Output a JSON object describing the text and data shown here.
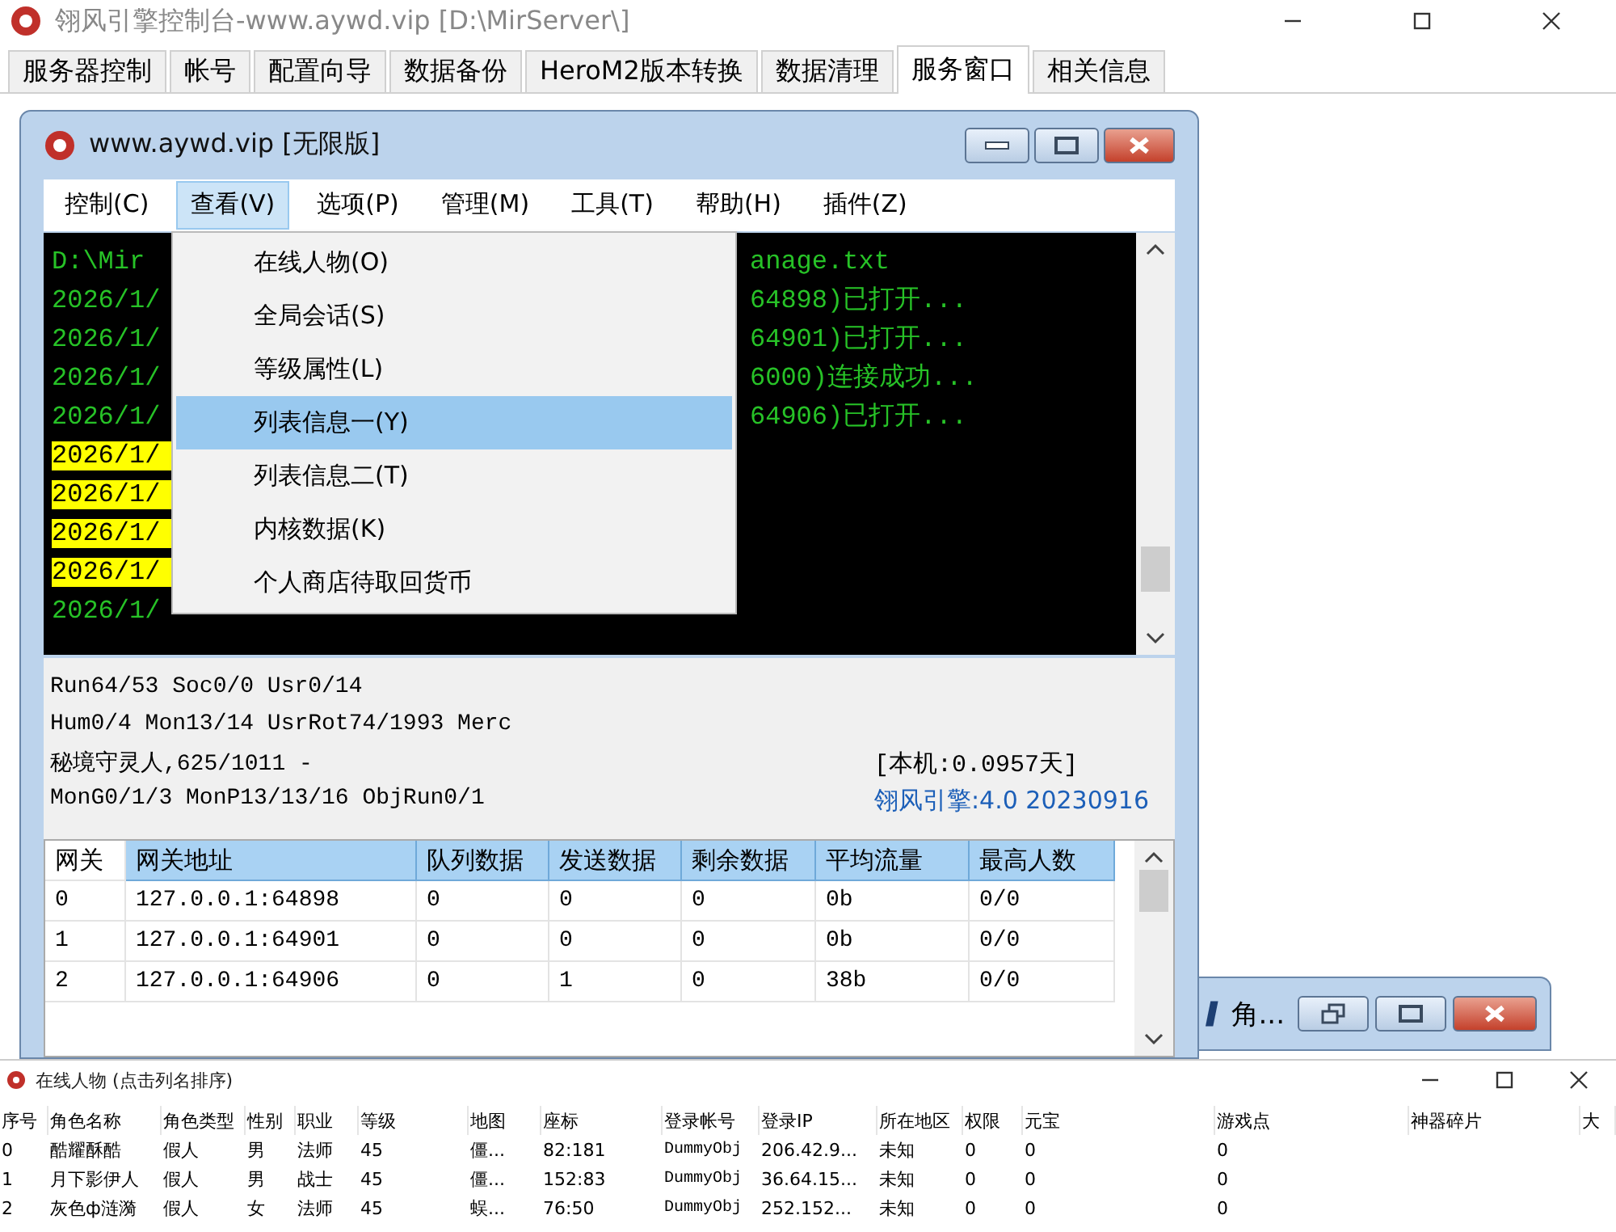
{
  "window": {
    "title": "翎风引擎控制台-www.aywd.vip [D:\\MirServer\\]"
  },
  "tabs": [
    {
      "label": "服务器控制",
      "selected": false
    },
    {
      "label": "帐号",
      "selected": false
    },
    {
      "label": "配置向导",
      "selected": false
    },
    {
      "label": "数据备份",
      "selected": false
    },
    {
      "label": "HeroM2版本转换",
      "selected": false
    },
    {
      "label": "数据清理",
      "selected": false
    },
    {
      "label": "服务窗口",
      "selected": true
    },
    {
      "label": "相关信息",
      "selected": false
    }
  ],
  "server_window": {
    "title": "www.aywd.vip [无限版]",
    "menu": [
      {
        "label": "控制(C)",
        "selected": false
      },
      {
        "label": "查看(V)",
        "selected": true
      },
      {
        "label": "选项(P)",
        "selected": false
      },
      {
        "label": "管理(M)",
        "selected": false
      },
      {
        "label": "工具(T)",
        "selected": false
      },
      {
        "label": "帮助(H)",
        "selected": false
      },
      {
        "label": "插件(Z)",
        "selected": false
      }
    ],
    "dropdown": [
      {
        "label": "在线人物(O)",
        "selected": false
      },
      {
        "label": "全局会话(S)",
        "selected": false
      },
      {
        "label": "等级属性(L)",
        "selected": false
      },
      {
        "label": "列表信息一(Y)",
        "selected": true
      },
      {
        "label": "列表信息二(T)",
        "selected": false
      },
      {
        "label": "内核数据(K)",
        "selected": false
      },
      {
        "label": "个人商店待取回货币",
        "selected": false
      }
    ],
    "console": [
      {
        "left": "D:\\Mir",
        "right": "anage.txt",
        "highlighted": false
      },
      {
        "left": "2026/1/",
        "right": "64898)已打开...",
        "highlighted": false
      },
      {
        "left": "2026/1/",
        "right": "64901)已打开...",
        "highlighted": false
      },
      {
        "left": "2026/1/",
        "right": "6000)连接成功...",
        "highlighted": false
      },
      {
        "left": "2026/1/",
        "right": "64906)已打开...",
        "highlighted": false
      },
      {
        "left": "2026/1/",
        "highlighted": true
      },
      {
        "left": "2026/1/",
        "highlighted": true
      },
      {
        "left": "2026/1/",
        "highlighted": true
      },
      {
        "left": "2026/1/",
        "highlighted": true
      },
      {
        "left": "2026/1/",
        "highlighted": false
      }
    ],
    "status": {
      "lines": [
        "Run64/53 Soc0/0 Usr0/14",
        "Hum0/4 Mon13/14 UsrRot74/1993 Merc",
        "秘境守灵人,625/1011 -",
        "MonG0/1/3 MonP13/13/16 ObjRun0/1"
      ],
      "local_time": "[本机:0.0957天]",
      "version": "翎风引擎:4.0 20230916"
    },
    "gateway_table": {
      "columns": [
        {
          "label": "网关",
          "highlighted": false
        },
        {
          "label": "网关地址",
          "highlighted": true
        },
        {
          "label": "队列数据",
          "highlighted": true
        },
        {
          "label": "发送数据",
          "highlighted": true
        },
        {
          "label": "剩余数据",
          "highlighted": true
        },
        {
          "label": "平均流量",
          "highlighted": true
        },
        {
          "label": "最高人数",
          "highlighted": true
        }
      ],
      "rows": [
        [
          "0",
          "127.0.0.1:64898",
          "0",
          "0",
          "0",
          "0b",
          "0/0"
        ],
        [
          "1",
          "127.0.0.1:64901",
          "0",
          "0",
          "0",
          "0b",
          "0/0"
        ],
        [
          "2",
          "127.0.0.1:64906",
          "0",
          "1",
          "0",
          "38b",
          "0/0"
        ]
      ]
    }
  },
  "minimized_window": {
    "title": "角..."
  },
  "online_window": {
    "title": "在线人物 (点击列名排序)",
    "columns": [
      "序号",
      "角色名称",
      "角色类型",
      "性别",
      "职业",
      "等级",
      "地图",
      "座标",
      "登录帐号",
      "登录IP",
      "所在地区",
      "权限",
      "元宝",
      "游戏点",
      "神器碎片",
      "大"
    ],
    "rows": [
      [
        "0",
        "酷耀酥酷",
        "假人",
        "男",
        "法师",
        "45",
        "僵...",
        "82:181",
        "DummyObj",
        "206.42.9...",
        "未知",
        "0",
        "0",
        "0"
      ],
      [
        "1",
        "月下影伊人",
        "假人",
        "男",
        "战士",
        "45",
        "僵...",
        "152:83",
        "DummyObj",
        "36.64.15...",
        "未知",
        "0",
        "0",
        "0"
      ],
      [
        "2",
        "灰色ф涟漪",
        "假人",
        "女",
        "法师",
        "45",
        "蜈...",
        "76:50",
        "DummyObj",
        "252.152...",
        "未知",
        "0",
        "0",
        "0"
      ]
    ]
  }
}
